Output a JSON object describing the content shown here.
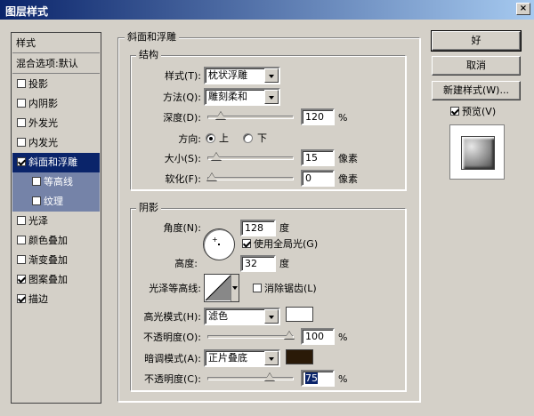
{
  "window": {
    "title": "图层样式",
    "close_glyph": "×"
  },
  "left_panel": {
    "header": "样式",
    "blend": "混合选项:默认",
    "items": [
      {
        "label": "投影",
        "checked": false
      },
      {
        "label": "内阴影",
        "checked": false
      },
      {
        "label": "外发光",
        "checked": false
      },
      {
        "label": "内发光",
        "checked": false
      },
      {
        "label": "斜面和浮雕",
        "checked": true,
        "selected": true
      },
      {
        "label": "等高线",
        "checked": false,
        "sub": true
      },
      {
        "label": "纹理",
        "checked": false,
        "sub": true
      },
      {
        "label": "光泽",
        "checked": false
      },
      {
        "label": "颜色叠加",
        "checked": false
      },
      {
        "label": "渐变叠加",
        "checked": false
      },
      {
        "label": "图案叠加",
        "checked": true
      },
      {
        "label": "描边",
        "checked": true
      }
    ]
  },
  "bevel": {
    "title": "斜面和浮雕",
    "structure": {
      "title": "结构",
      "style_label": "样式(T):",
      "style_value": "枕状浮雕",
      "technique_label": "方法(Q):",
      "technique_value": "雕刻柔和",
      "depth_label": "深度(D):",
      "depth_value": "120",
      "depth_unit": "%",
      "depth_level": 0.12,
      "direction_label": "方向:",
      "dir_up": "上",
      "dir_down": "下",
      "size_label": "大小(S):",
      "size_value": "15",
      "size_unit": "像素",
      "size_level": 0.06,
      "soften_label": "软化(F):",
      "soften_value": "0",
      "soften_unit": "像素",
      "soften_level": 0.0
    },
    "shading": {
      "title": "阴影",
      "angle_label": "角度(N):",
      "angle_value": "128",
      "angle_unit": "度",
      "global_light_label": "使用全局光(G)",
      "global_light_checked": true,
      "altitude_label": "高度:",
      "altitude_value": "32",
      "altitude_unit": "度",
      "gloss_label": "光泽等高线:",
      "antialias_label": "消除锯齿(L)",
      "antialias_checked": false,
      "highlight_mode_label": "高光模式(H):",
      "highlight_mode_value": "滤色",
      "highlight_color": "#ffffff",
      "highlight_opacity_label": "不透明度(O):",
      "highlight_opacity_value": "100",
      "highlight_opacity_level": 1.0,
      "shadow_mode_label": "暗调模式(A):",
      "shadow_mode_value": "正片叠底",
      "shadow_color": "#2a1a08",
      "shadow_opacity_label": "不透明度(C):",
      "shadow_opacity_value": "75",
      "shadow_opacity_level": 0.75,
      "opacity_unit": "%"
    }
  },
  "buttons": {
    "ok": "好",
    "cancel": "取消",
    "new_style": "新建样式(W)...",
    "preview_label": "预览(V)",
    "preview_checked": true
  }
}
